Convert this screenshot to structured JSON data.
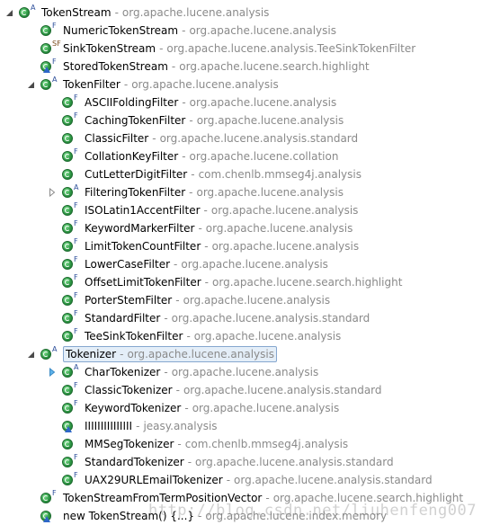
{
  "tree": {
    "rows": [
      {
        "name": "TokenStream",
        "pkg": "org.apache.lucene.analysis",
        "mod": "A",
        "expanded": true,
        "indent": 0
      },
      {
        "name": "NumericTokenStream",
        "pkg": "org.apache.lucene.analysis",
        "mod": "F",
        "indent": 1
      },
      {
        "name": "SinkTokenStream",
        "pkg": "org.apache.lucene.analysis.TeeSinkTokenFilter",
        "mod": "SF",
        "indent": 1
      },
      {
        "name": "StoredTokenStream",
        "pkg": "org.apache.lucene.search.highlight",
        "mod": "F",
        "warn": true,
        "indent": 1
      },
      {
        "name": "TokenFilter",
        "pkg": "org.apache.lucene.analysis",
        "mod": "A",
        "expanded": true,
        "indent": 1
      },
      {
        "name": "ASCIIFoldingFilter",
        "pkg": "org.apache.lucene.analysis",
        "mod": "F",
        "indent": 2
      },
      {
        "name": "CachingTokenFilter",
        "pkg": "org.apache.lucene.analysis",
        "mod": "F",
        "indent": 2
      },
      {
        "name": "ClassicFilter",
        "pkg": "org.apache.lucene.analysis.standard",
        "mod": "",
        "indent": 2
      },
      {
        "name": "CollationKeyFilter",
        "pkg": "org.apache.lucene.collation",
        "mod": "F",
        "indent": 2
      },
      {
        "name": "CutLetterDigitFilter",
        "pkg": "com.chenlb.mmseg4j.analysis",
        "mod": "",
        "indent": 2
      },
      {
        "name": "FilteringTokenFilter",
        "pkg": "org.apache.lucene.analysis",
        "mod": "A",
        "collapsed": true,
        "indent": 2
      },
      {
        "name": "ISOLatin1AccentFilter",
        "pkg": "org.apache.lucene.analysis",
        "mod": "F",
        "indent": 2
      },
      {
        "name": "KeywordMarkerFilter",
        "pkg": "org.apache.lucene.analysis",
        "mod": "F",
        "indent": 2
      },
      {
        "name": "LimitTokenCountFilter",
        "pkg": "org.apache.lucene.analysis",
        "mod": "F",
        "indent": 2
      },
      {
        "name": "LowerCaseFilter",
        "pkg": "org.apache.lucene.analysis",
        "mod": "F",
        "indent": 2
      },
      {
        "name": "OffsetLimitTokenFilter",
        "pkg": "org.apache.lucene.search.highlight",
        "mod": "F",
        "indent": 2
      },
      {
        "name": "PorterStemFilter",
        "pkg": "org.apache.lucene.analysis",
        "mod": "F",
        "indent": 2
      },
      {
        "name": "StandardFilter",
        "pkg": "org.apache.lucene.analysis.standard",
        "mod": "F",
        "indent": 2
      },
      {
        "name": "TeeSinkTokenFilter",
        "pkg": "org.apache.lucene.analysis",
        "mod": "F",
        "indent": 2
      },
      {
        "name": "Tokenizer",
        "pkg": "org.apache.lucene.analysis",
        "mod": "A",
        "expanded": true,
        "selected": true,
        "indent": 1
      },
      {
        "name": "CharTokenizer",
        "pkg": "org.apache.lucene.analysis",
        "mod": "A",
        "collapsedBlue": true,
        "indent": 2
      },
      {
        "name": "ClassicTokenizer",
        "pkg": "org.apache.lucene.analysis.standard",
        "mod": "F",
        "indent": 2
      },
      {
        "name": "KeywordTokenizer",
        "pkg": "org.apache.lucene.analysis",
        "mod": "F",
        "indent": 2
      },
      {
        "name": "IIIIIIIIIIIIIII",
        "pkg": "jeasy.analysis",
        "mod": "",
        "warn": true,
        "indent": 2
      },
      {
        "name": "MMSegTokenizer",
        "pkg": "com.chenlb.mmseg4j.analysis",
        "mod": "",
        "indent": 2
      },
      {
        "name": "StandardTokenizer",
        "pkg": "org.apache.lucene.analysis.standard",
        "mod": "F",
        "indent": 2
      },
      {
        "name": "UAX29URLEmailTokenizer",
        "pkg": "org.apache.lucene.analysis.standard",
        "mod": "F",
        "indent": 2
      },
      {
        "name": "TokenStreamFromTermPositionVector",
        "pkg": "org.apache.lucene.search.highlight",
        "mod": "F",
        "indent": 1
      },
      {
        "name": "new TokenStream() {...}",
        "pkg": "org.apache.lucene.index.memory",
        "mod": "",
        "warn": true,
        "indent": 1
      }
    ],
    "separator": "-"
  },
  "watermark": "http://blog.csdn.net/liuhenfeng007",
  "colors": {
    "package": "#8a8a8a",
    "selection_bg": "#e4eef8",
    "selection_border": "#86a7cf",
    "class_icon": "#2f9a46"
  }
}
